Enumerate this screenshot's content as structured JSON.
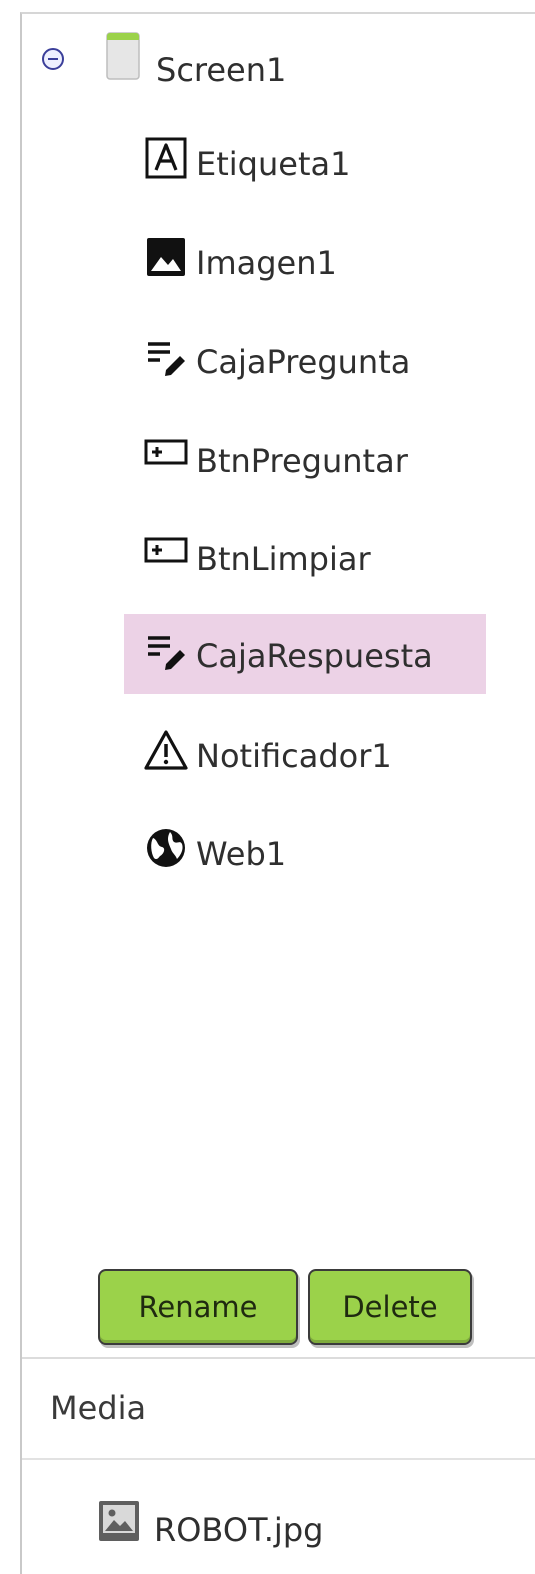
{
  "components": {
    "root": {
      "label": "Screen1",
      "icon": "screen-icon"
    },
    "items": [
      {
        "label": "Etiqueta1",
        "icon": "label-text-icon"
      },
      {
        "label": "Imagen1",
        "icon": "image-icon"
      },
      {
        "label": "CajaPregunta",
        "icon": "textbox-edit-icon"
      },
      {
        "label": "BtnPreguntar",
        "icon": "button-icon"
      },
      {
        "label": "BtnLimpiar",
        "icon": "button-icon"
      },
      {
        "label": "CajaRespuesta",
        "icon": "textbox-edit-icon",
        "selected": true
      },
      {
        "label": "Notificador1",
        "icon": "warning-triangle-icon"
      },
      {
        "label": "Web1",
        "icon": "globe-icon"
      }
    ],
    "rename_label": "Rename",
    "delete_label": "Delete"
  },
  "media": {
    "title": "Media",
    "items": [
      {
        "label": "ROBOT.jpg",
        "icon": "image-file-icon"
      }
    ]
  },
  "colors": {
    "selected_bg": "#ecd2e6",
    "button_green": "#9bd24a",
    "toggle_blue": "#3b3f9a"
  }
}
